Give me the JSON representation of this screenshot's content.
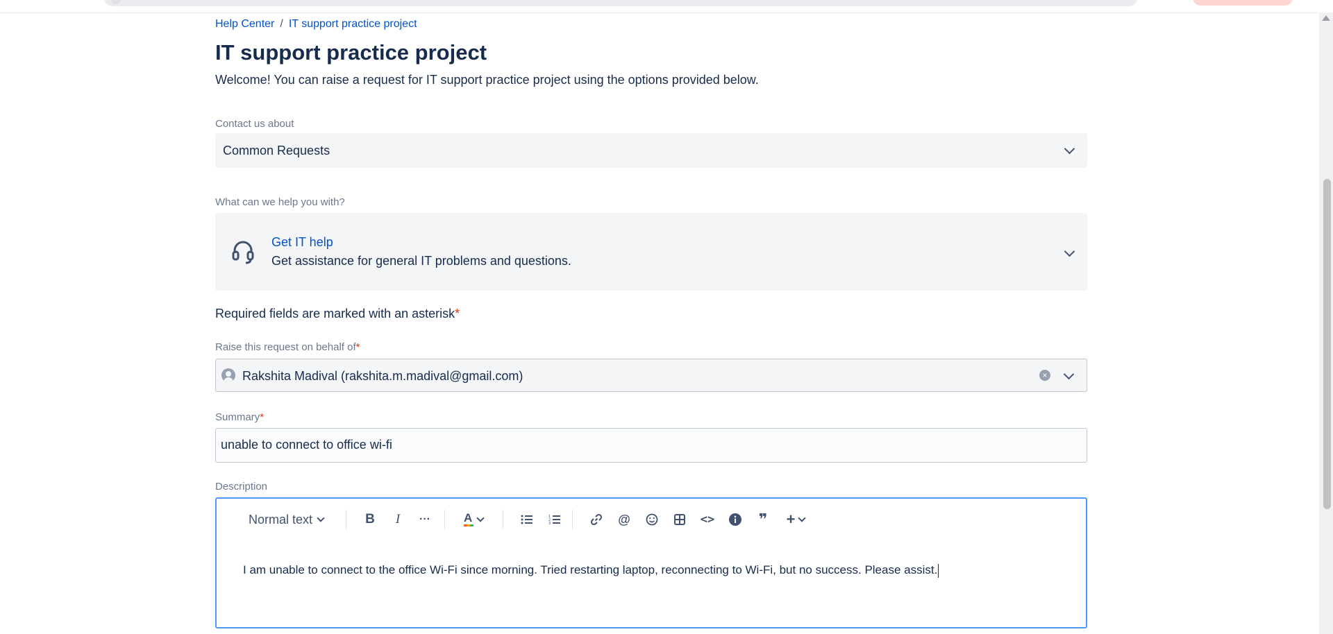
{
  "breadcrumb": {
    "home": "Help Center",
    "separator": "/",
    "project": "IT support practice project"
  },
  "page": {
    "title": "IT support practice project",
    "welcome": "Welcome! You can raise a request for IT support practice project using the options provided below."
  },
  "contact": {
    "label": "Contact us about",
    "value": "Common Requests"
  },
  "help": {
    "label": "What can we help you with?",
    "title": "Get IT help",
    "description": "Get assistance for general IT problems and questions.",
    "icon": "headset-icon"
  },
  "required_note": {
    "text": "Required fields are marked with an asterisk",
    "asterisk": "*"
  },
  "behalf": {
    "label": "Raise this request on behalf of",
    "asterisk": "*",
    "value": "Rakshita Madival (rakshita.m.madival@gmail.com)",
    "clear_glyph": "×"
  },
  "summary": {
    "label": "Summary",
    "asterisk": "*",
    "value": "unable to connect to office wi-fi"
  },
  "description": {
    "label": "Description",
    "text_style": "Normal text",
    "body": "I am unable to connect to the office Wi-Fi since morning. Tried restarting laptop, reconnecting to Wi-Fi, but no success. Please assist."
  },
  "toolbar_glyphs": {
    "bold": "B",
    "italic": "I",
    "more": "···",
    "text_color": "A",
    "mention": "@",
    "code": "<>",
    "quote": "❞",
    "insert": "+"
  },
  "colors": {
    "link": "#0052cc",
    "text": "#172b4d",
    "label": "#6b778c",
    "required": "#de350b",
    "field_bg": "#f4f5f7",
    "focus_border": "#4c9aff"
  }
}
